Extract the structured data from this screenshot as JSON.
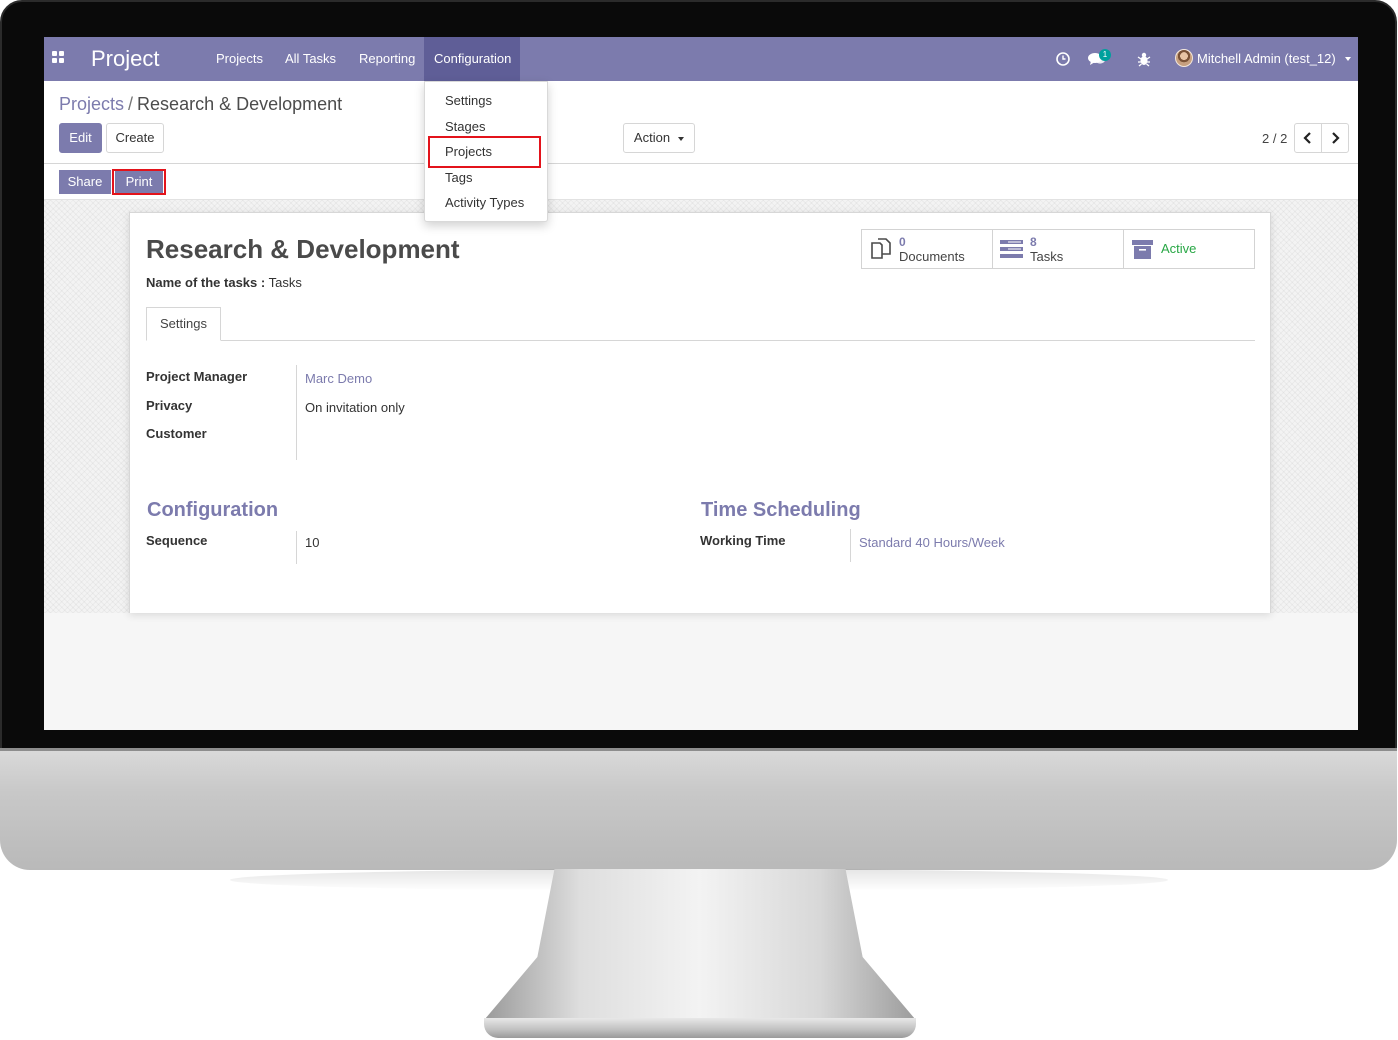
{
  "navbar": {
    "app_name": "Project",
    "menus": [
      "Projects",
      "All Tasks",
      "Reporting",
      "Configuration"
    ],
    "active_menu": "Configuration",
    "messages_count": "1",
    "user": "Mitchell Admin (test_12)",
    "accent_color": "#7c7bad"
  },
  "config_menu": {
    "items": [
      "Settings",
      "Stages",
      "Projects",
      "Tags",
      "Activity Types"
    ],
    "highlighted": "Projects"
  },
  "breadcrumb": {
    "parent": "Projects",
    "separator": "/",
    "current": "Research & Development"
  },
  "buttons": {
    "edit": "Edit",
    "create": "Create",
    "action": "Action",
    "share": "Share",
    "print": "Print"
  },
  "pager": {
    "value": "2 / 2"
  },
  "record": {
    "title": "Research & Development",
    "tasks_name_label": "Name of the tasks :",
    "tasks_name_value": "Tasks"
  },
  "smart_buttons": {
    "documents": {
      "count": "0",
      "label": "Documents"
    },
    "tasks": {
      "count": "8",
      "label": "Tasks"
    },
    "active": {
      "label": "Active",
      "color": "#28a745"
    }
  },
  "tabs": {
    "settings": "Settings"
  },
  "fields": {
    "project_manager": {
      "label": "Project Manager",
      "value": "Marc Demo"
    },
    "privacy": {
      "label": "Privacy",
      "value": "On invitation only"
    },
    "customer": {
      "label": "Customer",
      "value": ""
    }
  },
  "configuration": {
    "title": "Configuration",
    "sequence_label": "Sequence",
    "sequence_value": "10"
  },
  "time_scheduling": {
    "title": "Time Scheduling",
    "working_time_label": "Working Time",
    "working_time_value": "Standard 40 Hours/Week"
  }
}
